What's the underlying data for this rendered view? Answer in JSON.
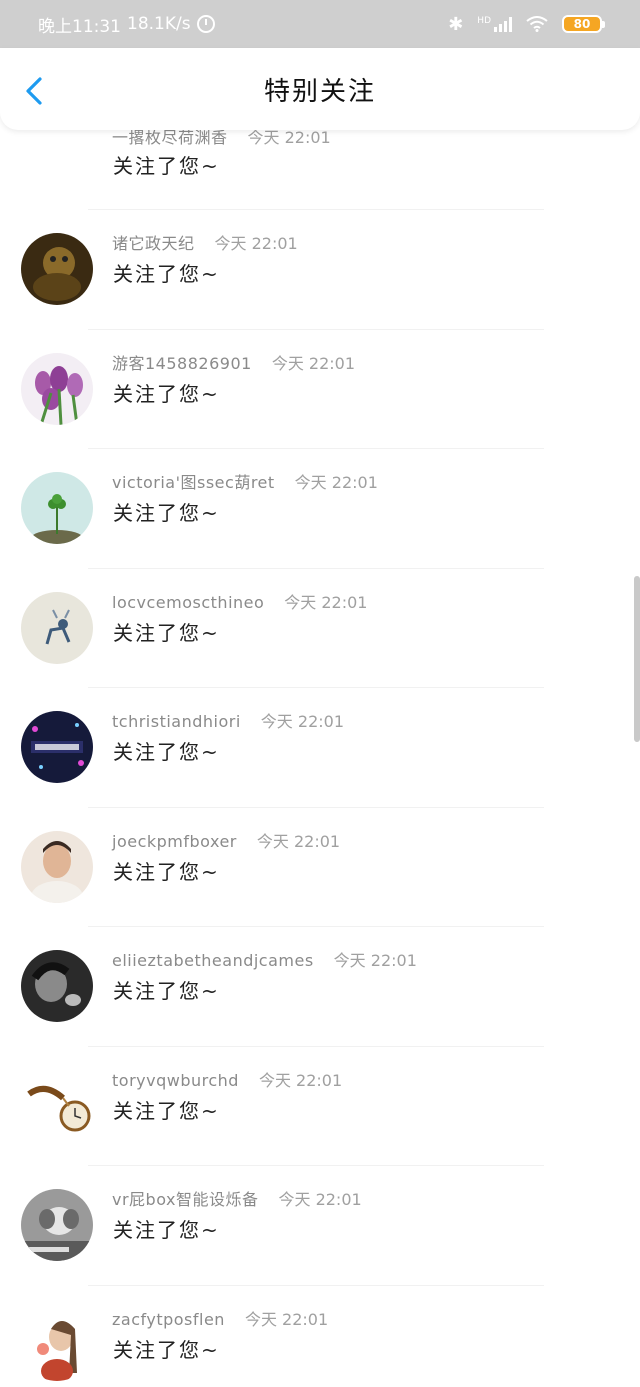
{
  "status_bar": {
    "time": "晚上11:31",
    "speed": "18.1K/s",
    "hd_label": "HD",
    "battery": "80",
    "battery_color": "#f5a623",
    "icons": [
      "alarm-icon",
      "bluetooth-icon",
      "signal-icon",
      "wifi-icon",
      "battery-icon"
    ]
  },
  "header": {
    "title": "特别关注",
    "back_icon": "chevron-left-icon",
    "accent_color": "#1e9bf0"
  },
  "partial_item": {
    "name": "一撂枚尽荷渊香",
    "time": "今天 22:01",
    "message": "关注了您~"
  },
  "items": [
    {
      "name": "诸它政天纪",
      "time": "今天 22:01",
      "message": "关注了您~",
      "avatar": "avatar-icon"
    },
    {
      "name": "游客1458826901",
      "time": "今天 22:01",
      "message": "关注了您~",
      "avatar": "avatar-icon"
    },
    {
      "name": "victoria'图ssec葫ret",
      "time": "今天 22:01",
      "message": "关注了您~",
      "avatar": "avatar-icon"
    },
    {
      "name": "locvcemoscthineo",
      "time": "今天 22:01",
      "message": "关注了您~",
      "avatar": "avatar-icon"
    },
    {
      "name": "tchristiandhiori",
      "time": "今天 22:01",
      "message": "关注了您~",
      "avatar": "avatar-icon"
    },
    {
      "name": "joeckpmfboxer",
      "time": "今天 22:01",
      "message": "关注了您~",
      "avatar": "avatar-icon"
    },
    {
      "name": "eliieztabetheandjcames",
      "time": "今天 22:01",
      "message": "关注了您~",
      "avatar": "avatar-icon"
    },
    {
      "name": "toryvqwburchd",
      "time": "今天 22:01",
      "message": "关注了您~",
      "avatar": "avatar-icon"
    },
    {
      "name": "vr屁box智能设烁备",
      "time": "今天 22:01",
      "message": "关注了您~",
      "avatar": "avatar-icon"
    },
    {
      "name": "zacfytposflen",
      "time": "今天 22:01",
      "message": "关注了您~",
      "avatar": "avatar-icon"
    }
  ]
}
